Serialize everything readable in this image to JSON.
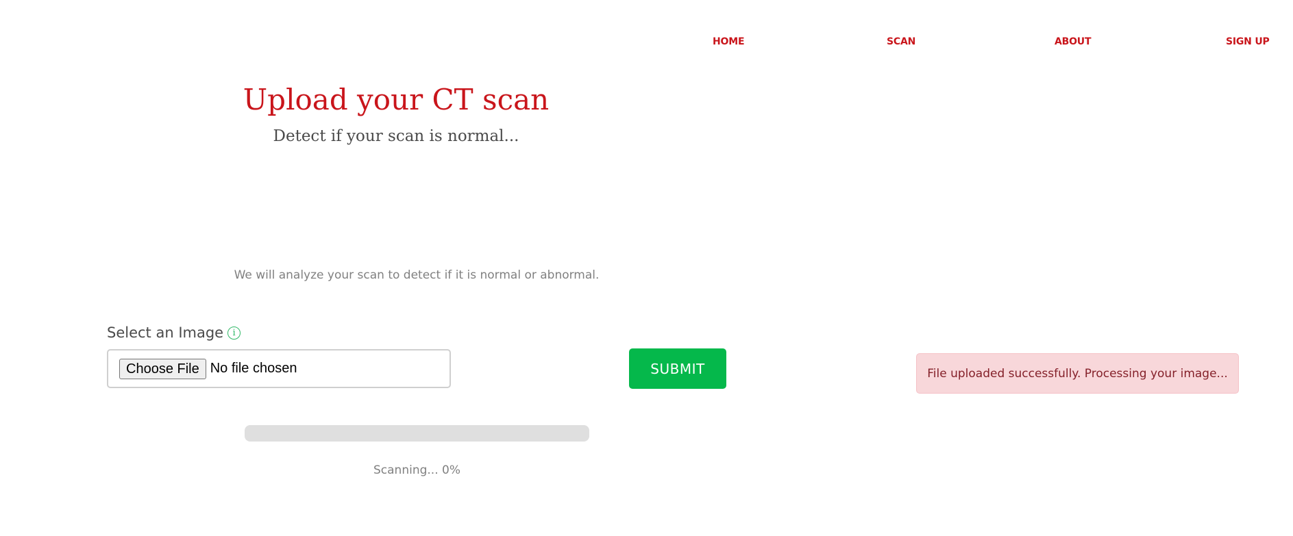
{
  "nav": {
    "items": [
      {
        "label": "HOME"
      },
      {
        "label": "SCAN"
      },
      {
        "label": "ABOUT"
      },
      {
        "label": "SIGN UP"
      }
    ]
  },
  "hero": {
    "title": "Upload your CT scan",
    "subtitle": "Detect if your scan is normal..."
  },
  "intro": {
    "text": "We will analyze your scan to detect if it is normal or abnormal."
  },
  "form": {
    "label": "Select an Image",
    "info_icon": "info-icon",
    "choose_file_label": "Choose File",
    "file_status": "No file chosen",
    "submit_label": "SUBMIT"
  },
  "progress": {
    "value_percent": 0,
    "text": "Scanning... 0%"
  },
  "alert": {
    "message": "File uploaded successfully. Processing your image..."
  },
  "colors": {
    "accent_red": "#c9151b",
    "submit_green": "#05b84b",
    "alert_bg": "#f8d7da",
    "alert_text": "#842029"
  }
}
